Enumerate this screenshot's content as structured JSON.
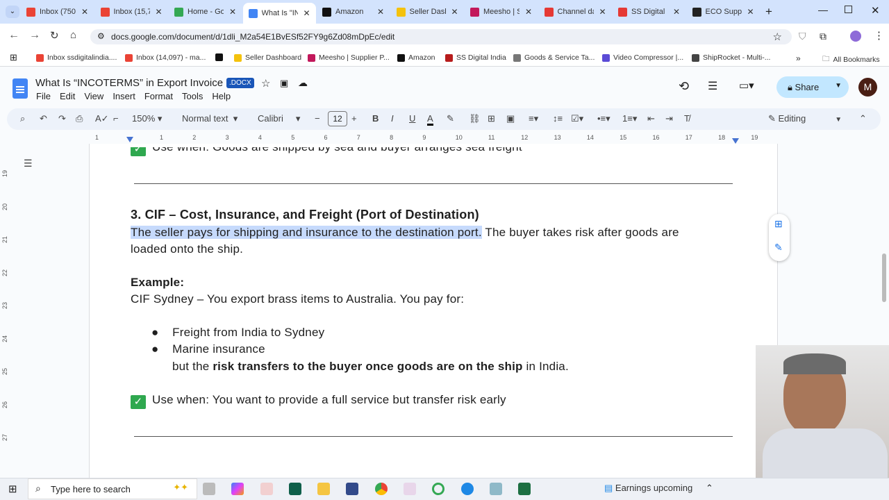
{
  "browser": {
    "tabs": [
      {
        "label": "Inbox (750",
        "color": "#ea4335"
      },
      {
        "label": "Inbox (15,7",
        "color": "#ea4335"
      },
      {
        "label": "Home - Go",
        "color": "#34a853"
      },
      {
        "label": "What Is \"IN",
        "color": "#4285f4",
        "active": true
      },
      {
        "label": "Amazon",
        "color": "#111111"
      },
      {
        "label": "Seller Dash",
        "color": "#f4c20d"
      },
      {
        "label": "Meesho | S",
        "color": "#c2185b"
      },
      {
        "label": "Channel da",
        "color": "#e53935"
      },
      {
        "label": "SS Digital I",
        "color": "#e53935"
      },
      {
        "label": "ECO Suppl",
        "color": "#222222"
      }
    ],
    "url": "docs.google.com/document/d/1dli_M2a54E1BvESf52FY9g6Zd08mDpEc/edit",
    "bookmarks": [
      {
        "label": "Inbox ssdigitalindia....",
        "color": "#ea4335"
      },
      {
        "label": "Inbox (14,097) - ma...",
        "color": "#ea4335"
      },
      {
        "label": "",
        "color": "#111111"
      },
      {
        "label": "Seller Dashboard",
        "color": "#f4c20d"
      },
      {
        "label": "Meesho | Supplier P...",
        "color": "#c2185b"
      },
      {
        "label": "Amazon",
        "color": "#111111"
      },
      {
        "label": "SS Digital India",
        "color": "#b71c1c"
      },
      {
        "label": "Goods & Service Ta...",
        "color": "#777777"
      },
      {
        "label": "Video Compressor |...",
        "color": "#5b4bd6"
      },
      {
        "label": "ShipRocket - Multi-...",
        "color": "#444444"
      }
    ],
    "all_bookmarks": "All Bookmarks"
  },
  "docs": {
    "title": "What Is “INCOTERMS” in Export Invoice",
    "badge": ".DOCX",
    "menu": [
      "File",
      "Edit",
      "View",
      "Insert",
      "Format",
      "Tools",
      "Help"
    ],
    "share": "Share",
    "avatar": "M",
    "zoom": "150%",
    "style": "Normal text",
    "font": "Calibri",
    "font_size": "12",
    "mode": "Editing",
    "ruler": [
      "1",
      "1",
      "2",
      "3",
      "4",
      "5",
      "6",
      "7",
      "8",
      "9",
      "10",
      "11",
      "12",
      "13",
      "14",
      "15",
      "16",
      "17",
      "18",
      "19"
    ],
    "vruler": [
      "19",
      "20",
      "21",
      "22",
      "23",
      "24",
      "25",
      "26",
      "27"
    ]
  },
  "document": {
    "prev_use_when": "Use when: Goods are shipped by sea and buyer arranges sea freight",
    "heading": "3. CIF – Cost, Insurance, and Freight (Port of Destination)",
    "para_selected": "The seller pays for shipping and insurance to the destination port.",
    "para_rest": " The buyer takes risk after goods are",
    "para_line2": "loaded onto the ship.",
    "example_label": "Example:",
    "example_text": "CIF Sydney – You export brass items to Australia. You pay for:",
    "bullets": [
      "Freight from India to Sydney",
      "Marine insurance"
    ],
    "but_pre": "but the ",
    "but_bold": "risk transfers to the buyer once goods are on the ship",
    "but_post": " in India.",
    "use_when": "Use when: You want to provide a full service but transfer risk early"
  },
  "taskbar": {
    "search": "Type here to search",
    "news": "Earnings upcoming"
  }
}
